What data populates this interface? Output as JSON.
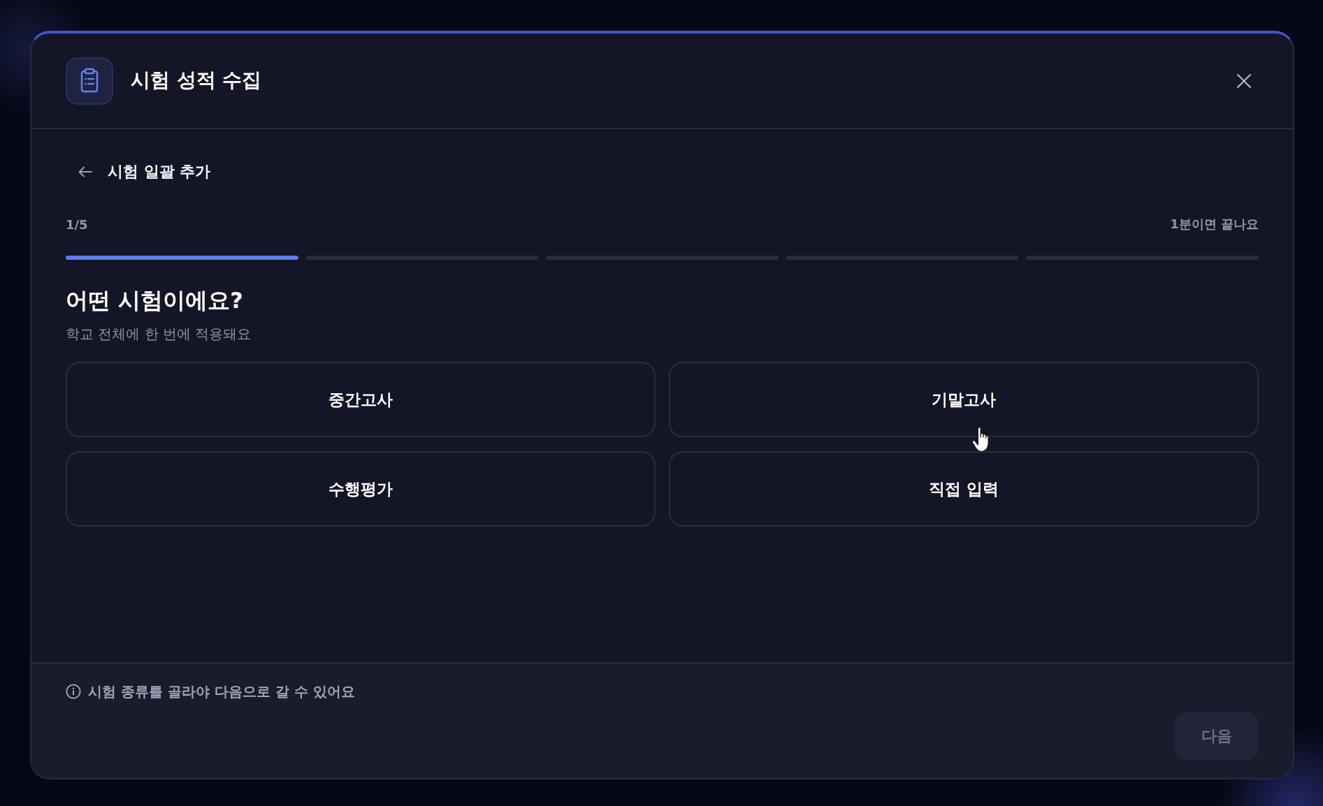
{
  "dialog": {
    "title": "시험 성적 수집"
  },
  "step_header": {
    "title": "시험 일괄 추가"
  },
  "progress": {
    "step_label": "1/5",
    "time_hint": "1분이면 끝나요",
    "segments": [
      {
        "completed": true
      },
      {
        "completed": false
      },
      {
        "completed": false
      },
      {
        "completed": false
      },
      {
        "completed": false
      }
    ]
  },
  "question": {
    "title": "어떤 시험이에요?",
    "subtitle": "학교 전체에 한 번에 적용돼요"
  },
  "options": [
    {
      "label": "중간고사",
      "selected": false
    },
    {
      "label": "기말고사",
      "selected": false
    },
    {
      "label": "수행평가",
      "selected": false
    },
    {
      "label": "직접 입력",
      "selected": false
    }
  ],
  "footer": {
    "hint": "시험 종류를 골라야 다음으로 갈 수 있어요",
    "next_button": {
      "label": "다음",
      "disabled": true
    }
  }
}
